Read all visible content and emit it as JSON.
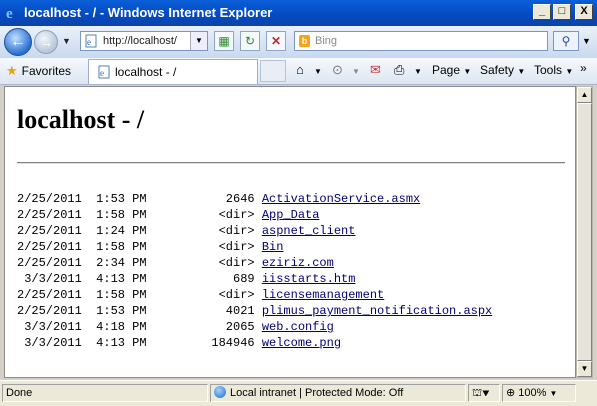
{
  "window": {
    "title": "localhost - / - Windows Internet Explorer",
    "min": "_",
    "max": "□",
    "close": "X"
  },
  "nav": {
    "back_icon": "back-arrow-icon",
    "forward_icon": "forward-arrow-icon",
    "address": "http://localhost/",
    "search_placeholder": "Bing"
  },
  "command_bar": {
    "favorites": "Favorites",
    "tab_title": "localhost - /",
    "page": "Page",
    "safety": "Safety",
    "tools": "Tools"
  },
  "page": {
    "heading": "localhost - /",
    "rows": [
      {
        "date": "2/25/2011",
        "time": "1:53 PM",
        "size": "2646",
        "name": "ActivationService.asmx"
      },
      {
        "date": "2/25/2011",
        "time": "1:58 PM",
        "size": "<dir>",
        "name": "App_Data"
      },
      {
        "date": "2/25/2011",
        "time": "1:24 PM",
        "size": "<dir>",
        "name": "aspnet_client"
      },
      {
        "date": "2/25/2011",
        "time": "1:58 PM",
        "size": "<dir>",
        "name": "Bin"
      },
      {
        "date": "2/25/2011",
        "time": "2:34 PM",
        "size": "<dir>",
        "name": "eziriz.com"
      },
      {
        "date": "3/3/2011",
        "time": "4:13 PM",
        "size": "689",
        "name": "iisstarts.htm"
      },
      {
        "date": "2/25/2011",
        "time": "1:58 PM",
        "size": "<dir>",
        "name": "licensemanagement"
      },
      {
        "date": "2/25/2011",
        "time": "1:53 PM",
        "size": "4021",
        "name": "plimus_payment_notification.aspx"
      },
      {
        "date": "3/3/2011",
        "time": "4:18 PM",
        "size": "2065",
        "name": "web.config"
      },
      {
        "date": "3/3/2011",
        "time": "4:13 PM",
        "size": "184946",
        "name": "welcome.png"
      }
    ]
  },
  "status": {
    "text": "Done",
    "zone": "Local intranet | Protected Mode: Off",
    "zoom": "100%"
  },
  "colors": {
    "link": "#00007a",
    "titlebar": "#0549c0"
  }
}
